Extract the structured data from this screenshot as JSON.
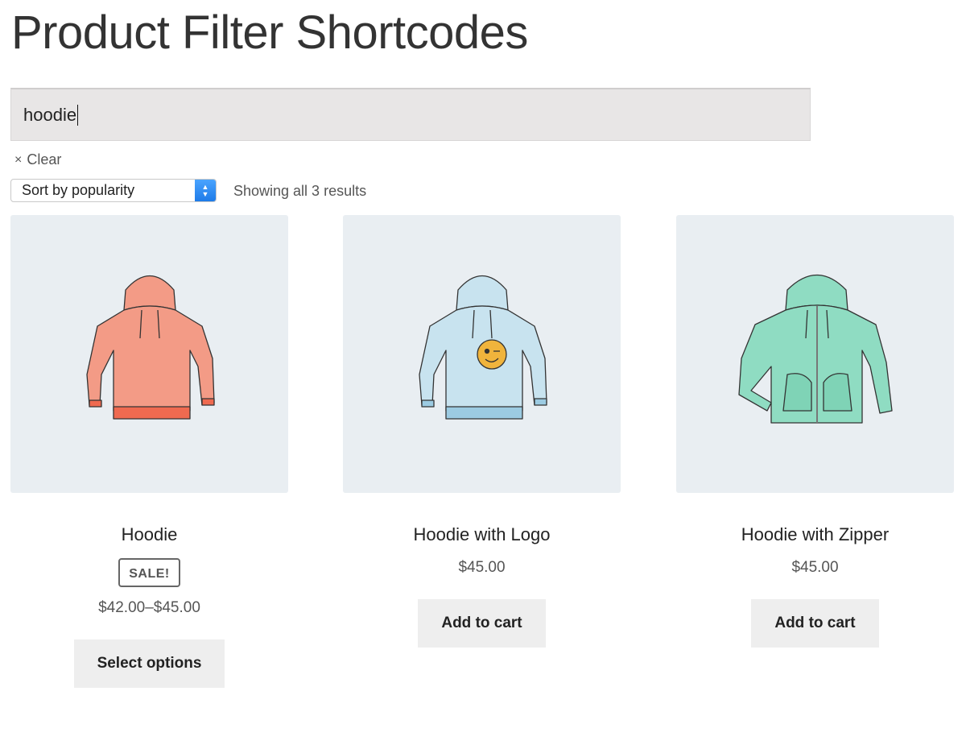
{
  "page": {
    "title": "Product Filter Shortcodes"
  },
  "search": {
    "value": "hoodie"
  },
  "filters": {
    "clear_symbol": "×",
    "clear_label": "Clear"
  },
  "sort": {
    "selected": "Sort by popularity",
    "stepper_up": "▲",
    "stepper_down": "▼"
  },
  "results": {
    "count_text": "Showing all 3 results"
  },
  "products": [
    {
      "name": "Hoodie",
      "badge": "SALE!",
      "price": "$42.00–$45.00",
      "button": "Select options",
      "color": "#f39b86",
      "trim": "#ef6a50"
    },
    {
      "name": "Hoodie with Logo",
      "price": "$45.00",
      "button": "Add to cart",
      "color": "#c8e3ef",
      "trim": "#9ccbe2",
      "logo_color": "#f0b43c"
    },
    {
      "name": "Hoodie with Zipper",
      "price": "$45.00",
      "button": "Add to cart",
      "color": "#8fdcc2",
      "trim": "#66c9a8"
    }
  ]
}
